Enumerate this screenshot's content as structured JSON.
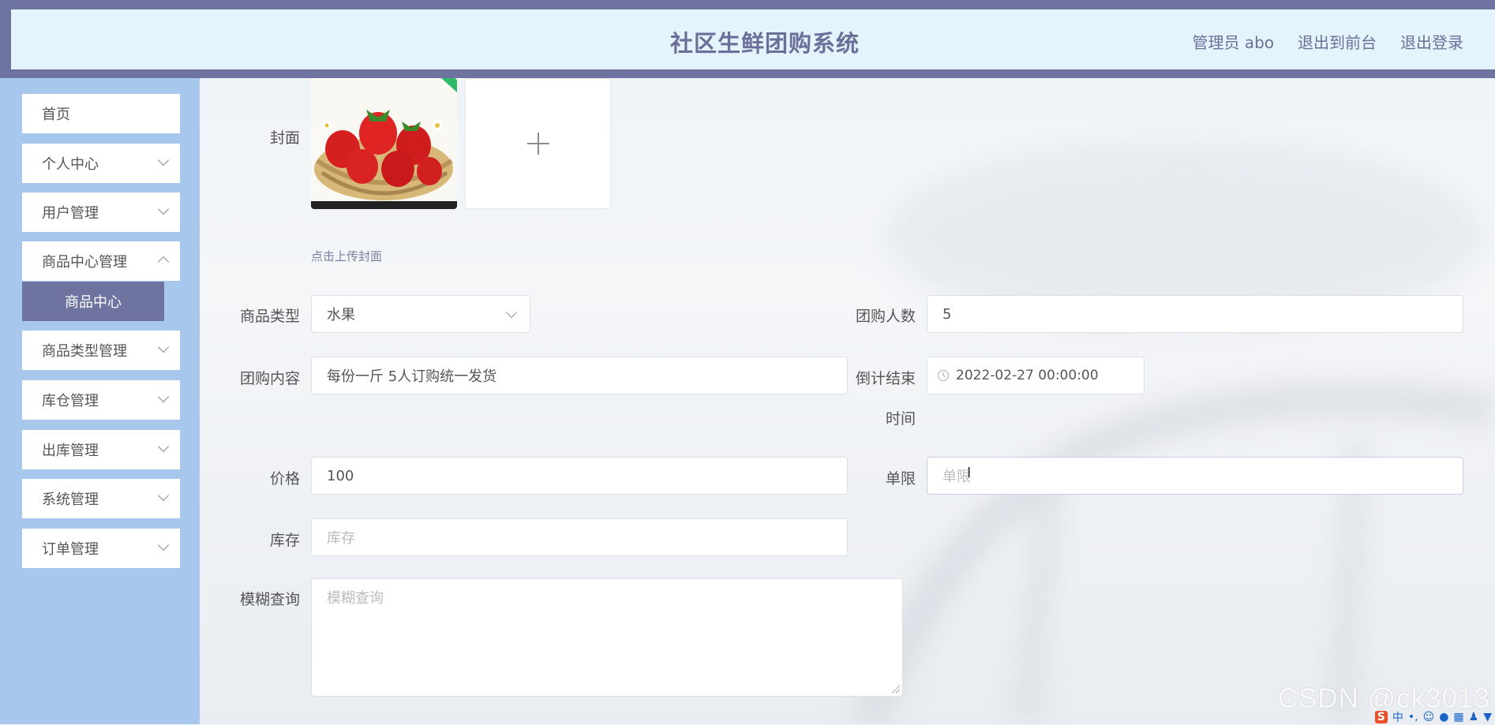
{
  "header": {
    "title": "社区生鲜团购系统",
    "user_label": "管理员 abo",
    "to_front_label": "退出到前台",
    "logout_label": "退出登录"
  },
  "sidebar": {
    "items": [
      {
        "label": "首页"
      },
      {
        "label": "个人中心"
      },
      {
        "label": "用户管理"
      },
      {
        "label": "商品中心管理"
      },
      {
        "label": "商品类型管理"
      },
      {
        "label": "库仓管理"
      },
      {
        "label": "出库管理"
      },
      {
        "label": "系统管理"
      },
      {
        "label": "订单管理"
      }
    ],
    "active_sub": "商品中心"
  },
  "form": {
    "cover_label": "封面",
    "cover_tip": "点击上传封面",
    "type_label": "商品类型",
    "type_value": "水果",
    "group_count_label": "团购人数",
    "group_count_value": "5",
    "content_label": "团购内容",
    "content_value": "每份一斤  5人订购统一发货",
    "countdown_label_1": "倒计结束",
    "countdown_label_2": "时间",
    "countdown_value": "2022-02-27 00:00:00",
    "price_label": "价格",
    "price_value": "100",
    "limit_label": "单限",
    "limit_placeholder": "单限",
    "stock_label": "库存",
    "stock_placeholder": "库存",
    "fuzzy_label": "模糊查询",
    "fuzzy_placeholder": "模糊查询"
  },
  "watermark": "CSDN @ck3013",
  "tray": {
    "ime": "S",
    "lang": "中"
  }
}
